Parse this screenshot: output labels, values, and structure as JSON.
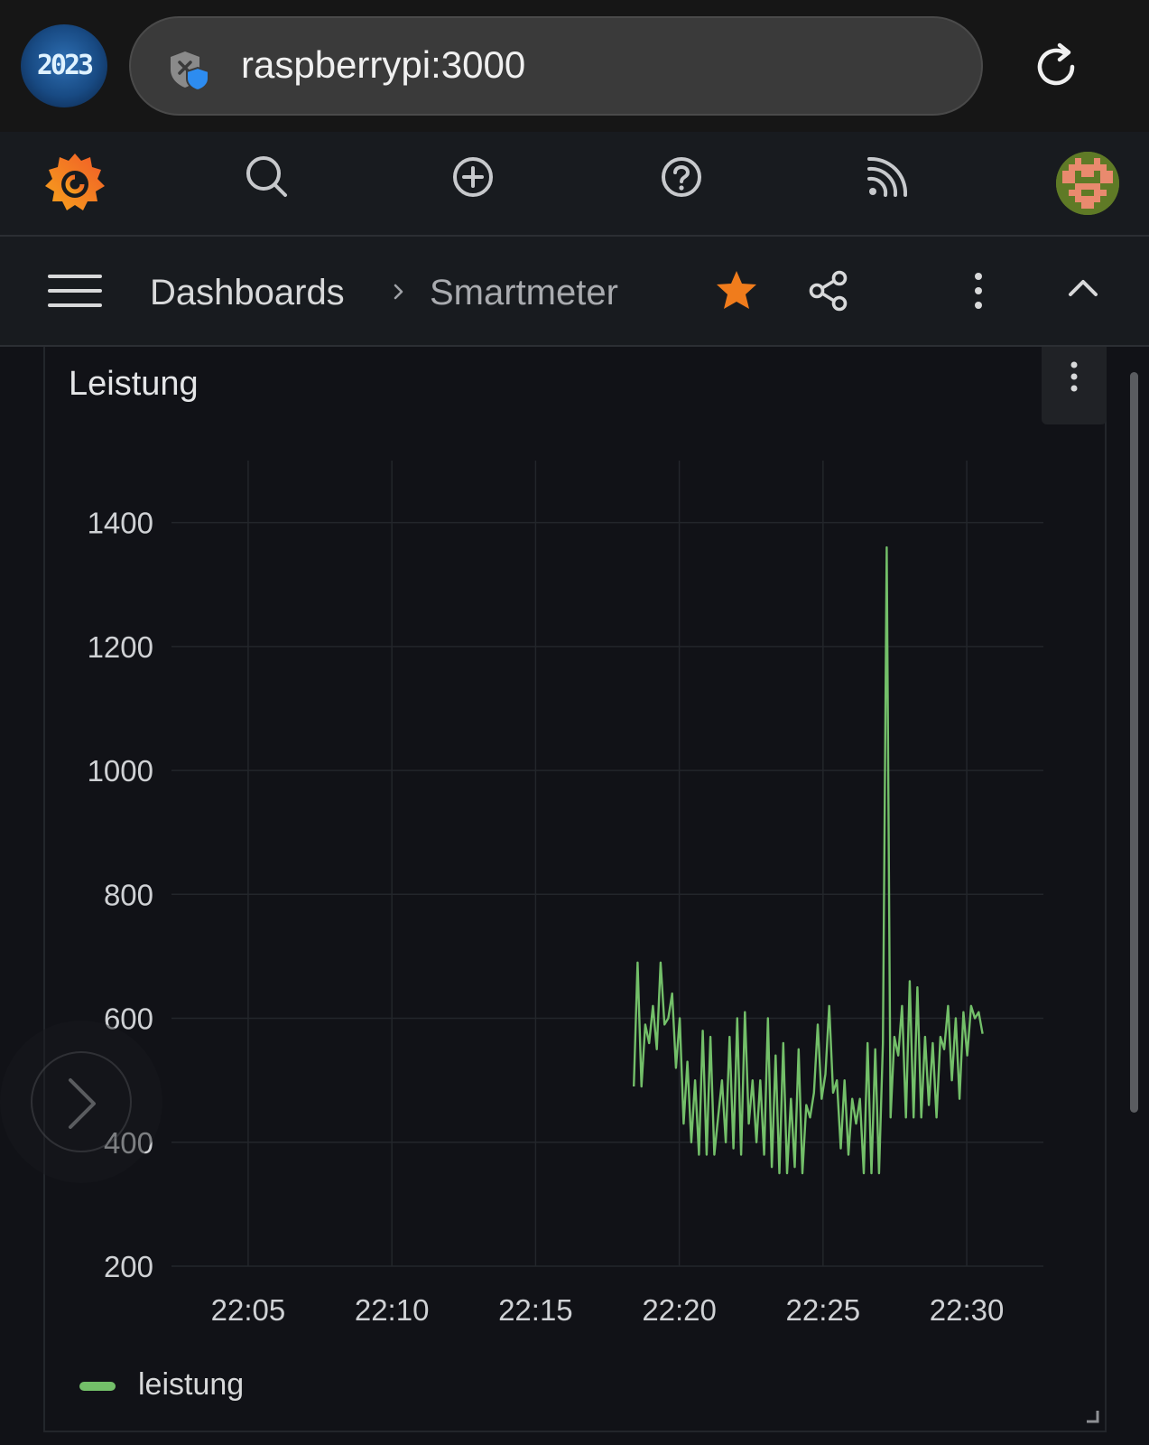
{
  "browser": {
    "url": "raspberrypi:3000",
    "site_logo_text": "2023"
  },
  "nav": {
    "icons": [
      "grafana-logo-icon",
      "search-icon",
      "add-icon",
      "help-icon",
      "news-icon",
      "user-avatar"
    ]
  },
  "breadcrumb": {
    "parent": "Dashboards",
    "current": "Smartmeter",
    "starred": true
  },
  "panel": {
    "title": "Leistung"
  },
  "colors": {
    "series": "#73bf69",
    "star": "#f07c1c",
    "background": "#111217"
  },
  "chart_data": {
    "type": "line",
    "x_unit": "time (HH:MM)",
    "x_ticks": [
      "22:05",
      "22:10",
      "22:15",
      "22:20",
      "22:25",
      "22:30"
    ],
    "y_ticks": [
      200,
      400,
      600,
      800,
      1000,
      1200,
      1400
    ],
    "xlim": [
      "22:02:20",
      "22:32:40"
    ],
    "ylim": [
      200,
      1500
    ],
    "grid": true,
    "legend": "bottom-left",
    "series": [
      {
        "name": "leistung",
        "color": "#73bf69",
        "points": [
          [
            "22:18:25",
            490
          ],
          [
            "22:18:33",
            690
          ],
          [
            "22:18:41",
            490
          ],
          [
            "22:18:49",
            590
          ],
          [
            "22:18:57",
            560
          ],
          [
            "22:19:05",
            620
          ],
          [
            "22:19:13",
            550
          ],
          [
            "22:19:21",
            690
          ],
          [
            "22:19:29",
            590
          ],
          [
            "22:19:37",
            600
          ],
          [
            "22:19:45",
            640
          ],
          [
            "22:19:53",
            520
          ],
          [
            "22:20:01",
            600
          ],
          [
            "22:20:09",
            430
          ],
          [
            "22:20:17",
            530
          ],
          [
            "22:20:25",
            400
          ],
          [
            "22:20:33",
            500
          ],
          [
            "22:20:41",
            380
          ],
          [
            "22:20:49",
            580
          ],
          [
            "22:20:57",
            380
          ],
          [
            "22:21:05",
            570
          ],
          [
            "22:21:13",
            380
          ],
          [
            "22:21:21",
            440
          ],
          [
            "22:21:29",
            500
          ],
          [
            "22:21:37",
            400
          ],
          [
            "22:21:45",
            570
          ],
          [
            "22:21:53",
            390
          ],
          [
            "22:22:01",
            600
          ],
          [
            "22:22:09",
            380
          ],
          [
            "22:22:17",
            610
          ],
          [
            "22:22:25",
            430
          ],
          [
            "22:22:33",
            500
          ],
          [
            "22:22:41",
            400
          ],
          [
            "22:22:49",
            500
          ],
          [
            "22:22:57",
            380
          ],
          [
            "22:23:05",
            600
          ],
          [
            "22:23:13",
            360
          ],
          [
            "22:23:21",
            540
          ],
          [
            "22:23:29",
            350
          ],
          [
            "22:23:37",
            560
          ],
          [
            "22:23:45",
            350
          ],
          [
            "22:23:53",
            470
          ],
          [
            "22:24:01",
            360
          ],
          [
            "22:24:09",
            550
          ],
          [
            "22:24:17",
            350
          ],
          [
            "22:24:25",
            460
          ],
          [
            "22:24:33",
            440
          ],
          [
            "22:24:41",
            480
          ],
          [
            "22:24:49",
            590
          ],
          [
            "22:24:57",
            470
          ],
          [
            "22:25:05",
            510
          ],
          [
            "22:25:13",
            620
          ],
          [
            "22:25:21",
            480
          ],
          [
            "22:25:29",
            500
          ],
          [
            "22:25:37",
            390
          ],
          [
            "22:25:45",
            500
          ],
          [
            "22:25:53",
            380
          ],
          [
            "22:26:01",
            470
          ],
          [
            "22:26:09",
            430
          ],
          [
            "22:26:17",
            470
          ],
          [
            "22:26:25",
            350
          ],
          [
            "22:26:33",
            560
          ],
          [
            "22:26:41",
            350
          ],
          [
            "22:26:49",
            550
          ],
          [
            "22:26:57",
            350
          ],
          [
            "22:27:05",
            560
          ],
          [
            "22:27:13",
            1360
          ],
          [
            "22:27:21",
            440
          ],
          [
            "22:27:29",
            570
          ],
          [
            "22:27:37",
            540
          ],
          [
            "22:27:45",
            620
          ],
          [
            "22:27:53",
            440
          ],
          [
            "22:28:01",
            660
          ],
          [
            "22:28:09",
            440
          ],
          [
            "22:28:17",
            650
          ],
          [
            "22:28:25",
            440
          ],
          [
            "22:28:33",
            570
          ],
          [
            "22:28:41",
            460
          ],
          [
            "22:28:49",
            560
          ],
          [
            "22:28:57",
            440
          ],
          [
            "22:29:05",
            570
          ],
          [
            "22:29:13",
            550
          ],
          [
            "22:29:21",
            620
          ],
          [
            "22:29:29",
            500
          ],
          [
            "22:29:37",
            600
          ],
          [
            "22:29:45",
            470
          ],
          [
            "22:29:53",
            610
          ],
          [
            "22:30:01",
            540
          ],
          [
            "22:30:09",
            620
          ],
          [
            "22:30:17",
            600
          ],
          [
            "22:30:25",
            610
          ],
          [
            "22:30:33",
            575
          ]
        ]
      }
    ]
  }
}
